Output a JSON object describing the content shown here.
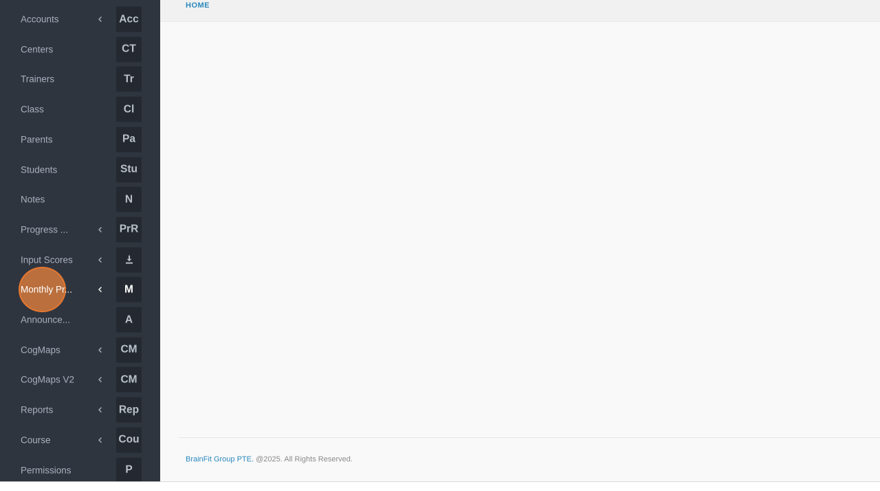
{
  "sidebar": {
    "items": [
      {
        "label": "Accounts",
        "abbr": "Acc",
        "has_submenu": true
      },
      {
        "label": "Centers",
        "abbr": "CT",
        "has_submenu": false
      },
      {
        "label": "Trainers",
        "abbr": "Tr",
        "has_submenu": false
      },
      {
        "label": "Class",
        "abbr": "Cl",
        "has_submenu": false
      },
      {
        "label": "Parents",
        "abbr": "Pa",
        "has_submenu": false
      },
      {
        "label": "Students",
        "abbr": "Stu",
        "has_submenu": false
      },
      {
        "label": "Notes",
        "abbr": "N",
        "has_submenu": false
      },
      {
        "label": "Progress ...",
        "abbr": "PrR",
        "has_submenu": true
      },
      {
        "label": "Input Scores",
        "abbr": "",
        "icon": "download-icon",
        "has_submenu": true
      },
      {
        "label": "Monthly Pr...",
        "abbr": "M",
        "has_submenu": true,
        "active": true
      },
      {
        "label": "Announce...",
        "abbr": "A",
        "has_submenu": false
      },
      {
        "label": "CogMaps",
        "abbr": "CM",
        "has_submenu": true
      },
      {
        "label": "CogMaps V2",
        "abbr": "CM",
        "has_submenu": true
      },
      {
        "label": "Reports",
        "abbr": "Rep",
        "has_submenu": true
      },
      {
        "label": "Course",
        "abbr": "Cou",
        "has_submenu": true
      },
      {
        "label": "Permissions",
        "abbr": "P",
        "has_submenu": false
      }
    ]
  },
  "header": {
    "breadcrumb": "HOME"
  },
  "footer": {
    "company": "BrainFit Group PTE.",
    "copyright": " @2025. All Rights Reserved."
  },
  "colors": {
    "sidebar_bg": "#2f353f",
    "abbr_bg": "#242931",
    "accent": "#2a89bd",
    "click_marker": "#e2803c"
  }
}
